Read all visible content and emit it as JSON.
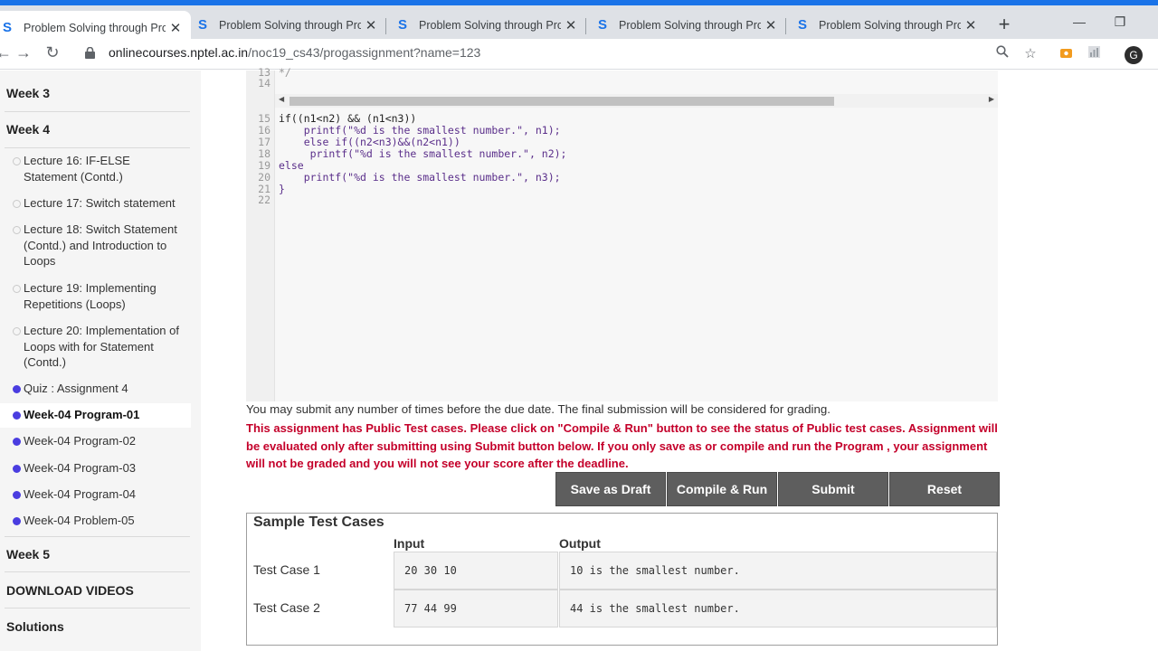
{
  "browser": {
    "tabs": [
      {
        "title": "Problem Solving through Prog",
        "icon": "nptel-s-icon"
      },
      {
        "title": "Problem Solving through Prog",
        "icon": "nptel-s-icon"
      },
      {
        "title": "Problem Solving through Prog",
        "icon": "nptel-s-icon"
      },
      {
        "title": "Problem Solving through Prog",
        "icon": "nptel-s-icon"
      },
      {
        "title": "Problem Solving through Prog",
        "icon": "nptel-s-icon"
      }
    ],
    "url": {
      "host": "onlinecourses.nptel.ac.in",
      "path": "/noc19_cs43/progassignment?name=123"
    },
    "profile_initial": "G",
    "accent_color": "#1a73e8"
  },
  "sidebar": {
    "week3": "Week 3",
    "week4": "Week 4",
    "lessons": [
      {
        "label": "Lecture 16: IF-ELSE Statement (Contd.)",
        "status": "unvisited"
      },
      {
        "label": "Lecture 17: Switch statement",
        "status": "unvisited"
      },
      {
        "label": "Lecture 18: Switch Statement (Contd.) and Introduction to Loops",
        "status": "unvisited"
      },
      {
        "label": "Lecture 19: Implementing Repetitions (Loops)",
        "status": "unvisited"
      },
      {
        "label": "Lecture 20: Implementation of Loops with for Statement (Contd.)",
        "status": "unvisited"
      },
      {
        "label": "Quiz : Assignment 4",
        "status": "assignment"
      },
      {
        "label": "Week-04 Program-01",
        "status": "active"
      },
      {
        "label": "Week-04 Program-02",
        "status": "assignment"
      },
      {
        "label": "Week-04 Program-03",
        "status": "assignment"
      },
      {
        "label": "Week-04 Program-04",
        "status": "assignment"
      },
      {
        "label": "Week-04 Problem-05",
        "status": "assignment"
      }
    ],
    "week5": "Week 5",
    "download": "DOWNLOAD VIDEOS",
    "solutions": "Solutions",
    "assignment_dot_color": "#4a3de0"
  },
  "editor": {
    "line_numbers": [
      "13",
      "14",
      "15",
      "16",
      "17",
      "18",
      "19",
      "20",
      "21",
      "22"
    ],
    "code_lines": [
      "*/",
      "",
      "if((n1<n2) && (n1<n3))",
      "    printf(\"%d is the smallest number.\", n1);",
      "    else if((n2<n3)&&(n2<n1))",
      "     printf(\"%d is the smallest number.\", n2);",
      "else",
      "    printf(\"%d is the smallest number.\", n3);",
      "}",
      ""
    ]
  },
  "info": {
    "note": "You may submit any number of times before the due date. The final submission will be considered for grading.",
    "warning": "This assignment has Public Test cases. Please click on \"Compile & Run\" button to see the status of Public test cases. Assignment will be evaluated only after submitting using Submit button below. If you only save as or compile and run the Program , your assignment will not be graded and you will not see your score after the deadline.",
    "warning_color": "#c4002a"
  },
  "buttons": {
    "save_draft": "Save as Draft",
    "compile_run": "Compile & Run",
    "submit": "Submit",
    "reset": "Reset"
  },
  "tests": {
    "title": "Sample Test Cases",
    "input_header": "Input",
    "output_header": "Output",
    "cases": [
      {
        "label": "Test Case 1",
        "input": "20 30 10",
        "output": "10 is the smallest number."
      },
      {
        "label": "Test Case 2",
        "input": "77 44 99",
        "output": "44 is the smallest number."
      }
    ]
  }
}
